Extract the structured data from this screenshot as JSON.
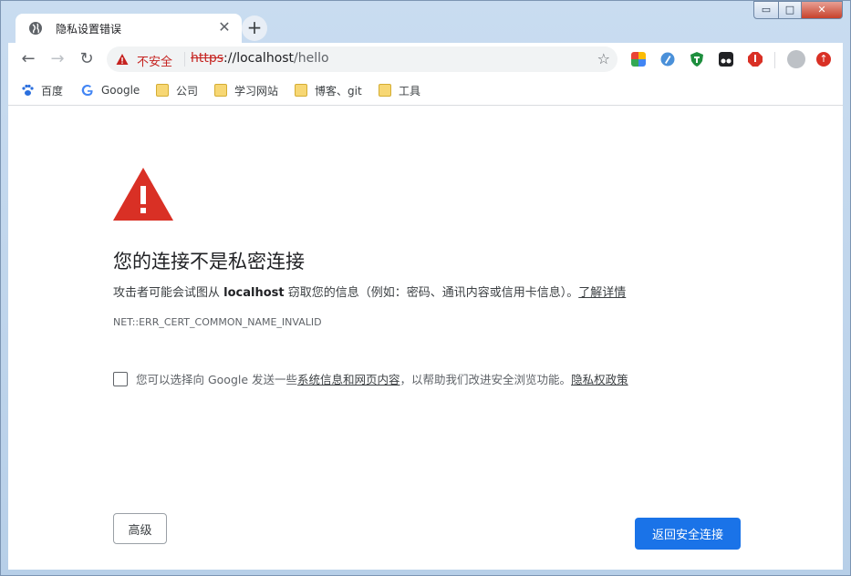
{
  "tab": {
    "title": "隐私设置错误",
    "favicon": "globe-icon",
    "close": "✕",
    "new_tab": "+"
  },
  "window_controls": {
    "minimize": "▭",
    "maximize": "□",
    "close": "✕"
  },
  "toolbar": {
    "back": "←",
    "forward": "→",
    "reload": "↻",
    "security_label": "不安全",
    "url_scheme": "https",
    "url_rest": "://localhost",
    "url_path": "/hello",
    "star": "☆",
    "extensions": [
      "colorful-app-icon",
      "pen-icon",
      "shield-icon",
      "tampermonkey-icon",
      "adblock-icon"
    ],
    "update": "↑"
  },
  "bookmarks": [
    {
      "label": "百度",
      "icon": "paw-icon"
    },
    {
      "label": "Google",
      "icon": "google-icon"
    },
    {
      "label": "公司",
      "icon": "folder-icon"
    },
    {
      "label": "学习网站",
      "icon": "folder-icon"
    },
    {
      "label": "博客、git",
      "icon": "folder-icon"
    },
    {
      "label": "工具",
      "icon": "folder-icon"
    }
  ],
  "page": {
    "headline": "您的连接不是私密连接",
    "desc_before": "攻击者可能会试图从 ",
    "desc_host": "localhost",
    "desc_after": " 窃取您的信息（例如：密码、通讯内容或信用卡信息）。",
    "learn_more": "了解详情",
    "error_code": "NET::ERR_CERT_COMMON_NAME_INVALID",
    "opt_before": "您可以选择向 Google 发送一些",
    "opt_link": "系统信息和网页内容",
    "opt_after": "，以帮助我们改进安全浏览功能。",
    "privacy_link": "隐私权政策",
    "advanced_button": "高级",
    "back_button": "返回安全连接"
  },
  "colors": {
    "accent": "#1a73e8",
    "danger": "#d93025"
  }
}
